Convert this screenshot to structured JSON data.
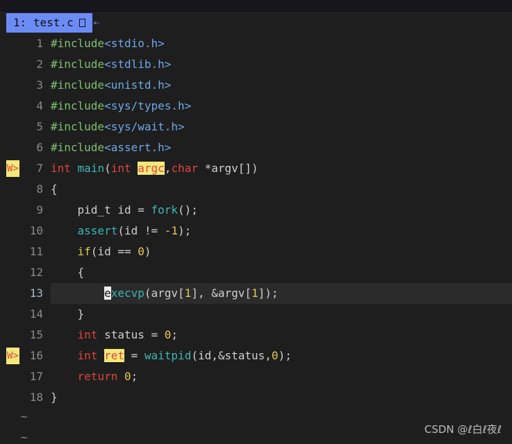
{
  "tabline": {
    "tab_label": "1: test.c",
    "close_glyph": "",
    "arrow": "⇠"
  },
  "sign_text": "W>",
  "lines": [
    {
      "num": "1",
      "parts": [
        [
          "pre",
          "#include"
        ],
        [
          "ang",
          "<stdio.h>"
        ]
      ]
    },
    {
      "num": "2",
      "parts": [
        [
          "pre",
          "#include"
        ],
        [
          "ang",
          "<stdlib.h>"
        ]
      ]
    },
    {
      "num": "3",
      "parts": [
        [
          "pre",
          "#include"
        ],
        [
          "ang",
          "<unistd.h>"
        ]
      ]
    },
    {
      "num": "4",
      "parts": [
        [
          "pre",
          "#include"
        ],
        [
          "ang",
          "<sys/types.h>"
        ]
      ]
    },
    {
      "num": "5",
      "parts": [
        [
          "pre",
          "#include"
        ],
        [
          "ang",
          "<sys/wait.h>"
        ]
      ]
    },
    {
      "num": "6",
      "parts": [
        [
          "pre",
          "#include"
        ],
        [
          "ang",
          "<assert.h>"
        ]
      ]
    },
    {
      "num": "7",
      "sign": true,
      "parts": [
        [
          "ty",
          "int"
        ],
        [
          "",
          ""
        ],
        [
          "plain",
          " "
        ],
        [
          "fn",
          "main"
        ],
        [
          "plain",
          "("
        ],
        [
          "ty",
          "int"
        ],
        [
          "plain",
          " "
        ],
        [
          "hl",
          "argc"
        ],
        [
          "plain",
          ","
        ],
        [
          "ty",
          "char"
        ],
        [
          "plain",
          " *argv[])"
        ]
      ]
    },
    {
      "num": "8",
      "parts": [
        [
          "plain",
          "{"
        ]
      ]
    },
    {
      "num": "9",
      "parts": [
        [
          "plain",
          "    pid_t id = "
        ],
        [
          "fn",
          "fork"
        ],
        [
          "plain",
          "();"
        ]
      ]
    },
    {
      "num": "10",
      "parts": [
        [
          "plain",
          "    "
        ],
        [
          "fn",
          "assert"
        ],
        [
          "plain",
          "(id != "
        ],
        [
          "num",
          "-1"
        ],
        [
          "plain",
          ");"
        ]
      ]
    },
    {
      "num": "11",
      "parts": [
        [
          "plain",
          "    "
        ],
        [
          "kw",
          "if"
        ],
        [
          "plain",
          "(id == "
        ],
        [
          "num",
          "0"
        ],
        [
          "plain",
          ")"
        ]
      ]
    },
    {
      "num": "12",
      "parts": [
        [
          "plain",
          "    {"
        ]
      ]
    },
    {
      "num": "13",
      "current": true,
      "parts": [
        [
          "plain",
          "        "
        ],
        [
          "cursor",
          "e"
        ],
        [
          "fn",
          "xecvp"
        ],
        [
          "plain",
          "(argv["
        ],
        [
          "num",
          "1"
        ],
        [
          "plain",
          "], &argv["
        ],
        [
          "num",
          "1"
        ],
        [
          "plain",
          "]);"
        ]
      ]
    },
    {
      "num": "14",
      "parts": [
        [
          "plain",
          "    }"
        ]
      ]
    },
    {
      "num": "15",
      "parts": [
        [
          "plain",
          "    "
        ],
        [
          "ty",
          "int"
        ],
        [
          "plain",
          " status = "
        ],
        [
          "num",
          "0"
        ],
        [
          "plain",
          ";"
        ]
      ]
    },
    {
      "num": "16",
      "sign": true,
      "parts": [
        [
          "plain",
          "    "
        ],
        [
          "ty",
          "int"
        ],
        [
          "plain",
          " "
        ],
        [
          "hl",
          "ret"
        ],
        [
          "plain",
          " = "
        ],
        [
          "fn",
          "waitpid"
        ],
        [
          "plain",
          "(id,&status,"
        ],
        [
          "num",
          "0"
        ],
        [
          "plain",
          ");"
        ]
      ]
    },
    {
      "num": "17",
      "parts": [
        [
          "plain",
          "    "
        ],
        [
          "ty",
          "return"
        ],
        [
          "plain",
          " "
        ],
        [
          "num",
          "0"
        ],
        [
          "plain",
          ";"
        ]
      ]
    },
    {
      "num": "18",
      "parts": [
        [
          "plain",
          "}"
        ]
      ]
    }
  ],
  "tildes": [
    "~",
    "~"
  ],
  "watermark": "CSDN @ℓ白ℓ夜ℓ",
  "colors": {
    "background": "#1e1e1e",
    "tab": "#6c8cf5",
    "preprocessor": "#7ec06e",
    "type": "#e0443c",
    "function": "#3fb6b6",
    "number": "#e6c85a",
    "highlight": "#f2e97b"
  }
}
